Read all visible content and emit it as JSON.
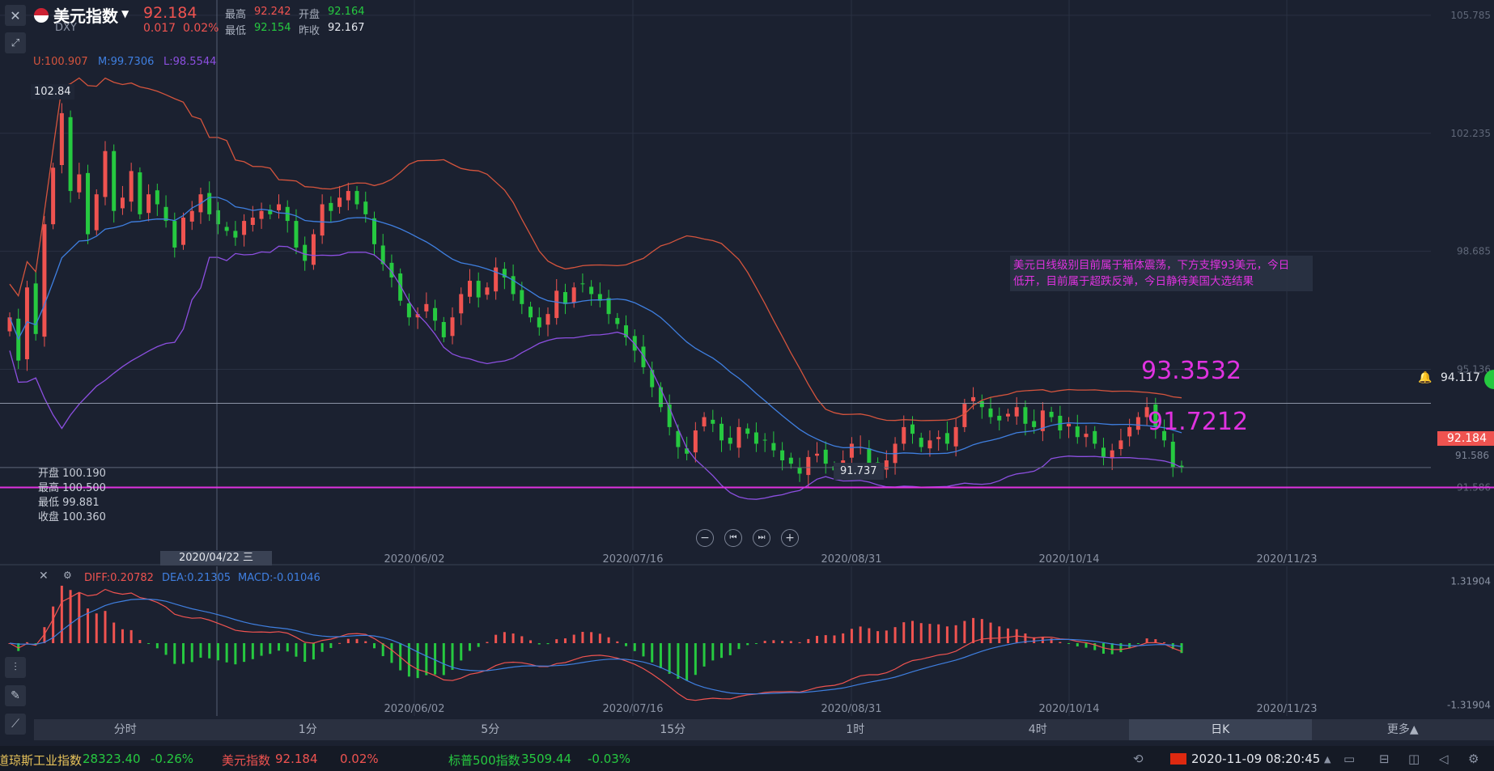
{
  "header": {
    "title": "美元指数",
    "symbol": "DXY",
    "price": "92.184",
    "change": "0.017",
    "change_pct": "0.02%",
    "high_label": "最高",
    "high": "92.242",
    "open_label": "开盘",
    "open": "92.164",
    "low_label": "最低",
    "low": "92.154",
    "prev_close_label": "昨收",
    "prev_close": "92.167"
  },
  "bollinger_legend": {
    "upper": "U:100.907",
    "middle": "M:99.7306",
    "lower": "L:98.5544"
  },
  "crosshair": {
    "ohlc": [
      "开盘 100.190",
      "最高 100.500",
      "最低 99.881",
      "收盘 100.360"
    ],
    "date_label": "2020/04/22 三"
  },
  "annotation": {
    "text_line1": "美元日线级别目前属于箱体震荡，下方支撑93美元，今日",
    "text_line2": "低开，目前属于超跌反弹，今日静待美国大选结果",
    "resistance_value": "93.3532",
    "support_value": "91.7212"
  },
  "price_tags": {
    "current": "92.184",
    "crosshair_level": "94.117",
    "high_marker": "102.84",
    "low_marker": "91.737",
    "support_line": "91.586"
  },
  "macd_legend": {
    "diff": "DIFF:0.20782",
    "dea": "DEA:0.21305",
    "macd": "MACD:-0.01046"
  },
  "timeframes": [
    "分时",
    "1分",
    "5分",
    "15分",
    "1时",
    "4时",
    "日K",
    "更多▲"
  ],
  "active_timeframe": "日K",
  "ticker": [
    {
      "name": "道琼斯工业指数",
      "price": "28323.40",
      "change": "-0.26%"
    },
    {
      "name": "美元指数",
      "price": "92.184",
      "change": "0.02%"
    },
    {
      "name": "标普500指数",
      "price": "3509.44",
      "change": "-0.03%"
    }
  ],
  "datetime": "2020-11-09 08:20:45",
  "colors": {
    "up": "#ef5350",
    "down": "#26c940",
    "upper_band": "#d4543d",
    "middle_band": "#3f7fe0",
    "lower_band": "#8c4fe0",
    "annotation": "#e032e0",
    "background": "#1b2130"
  },
  "chart_data": [
    {
      "type": "candlestick",
      "title": "美元指数 DXY",
      "x_ticks": [
        "2020/06/02",
        "2020/07/16",
        "2020/08/31",
        "2020/10/14",
        "2020/11/23"
      ],
      "y_ticks": [
        "105.785",
        "102.235",
        "98.685",
        "95.136",
        "91.586"
      ],
      "ylim": [
        89.7,
        106.0
      ],
      "closes": [
        96.7,
        95.4,
        97.6,
        96.2,
        99.5,
        101.2,
        102.84,
        100.5,
        101.0,
        99.2,
        100.4,
        101.7,
        99.9,
        100.3,
        101.1,
        99.8,
        100.4,
        100.1,
        99.6,
        98.8,
        99.7,
        99.9,
        100.4,
        99.8,
        99.5,
        99.3,
        99.1,
        99.6,
        99.7,
        99.9,
        99.8,
        100.1,
        99.6,
        98.8,
        98.4,
        99.2,
        100.1,
        99.9,
        100.3,
        100.5,
        100.1,
        99.8,
        98.9,
        98.3,
        97.9,
        97.2,
        96.7,
        96.8,
        97.1,
        96.6,
        96.1,
        96.7,
        97.4,
        97.8,
        97.3,
        97.6,
        98.2,
        97.9,
        97.4,
        97.1,
        96.7,
        96.4,
        96.8,
        97.5,
        97.1,
        97.6,
        97.7,
        97.4,
        97.2,
        96.8,
        96.5,
        96.1,
        95.7,
        95.2,
        94.6,
        94.0,
        93.4,
        92.8,
        92.6,
        93.3,
        93.7,
        93.5,
        93.0,
        92.9,
        93.4,
        93.2,
        92.9,
        93.0,
        92.7,
        92.4,
        92.3,
        92.0,
        92.5,
        92.6,
        92.3,
        92.1,
        92.4,
        92.9,
        92.8,
        92.3,
        92.0,
        92.4,
        92.9,
        93.4,
        93.2,
        92.8,
        93.0,
        93.1,
        92.9,
        93.4,
        94.1,
        94.3,
        94.0,
        93.7,
        93.6,
        93.8,
        94.0,
        93.5,
        93.4,
        93.9,
        93.7,
        93.3,
        93.5,
        93.1,
        93.2,
        92.9,
        92.5,
        92.7,
        93.0,
        93.4,
        93.7,
        94.0,
        93.4,
        93.0,
        92.2,
        92.18
      ],
      "series": [
        {
          "name": "U:100.907"
        },
        {
          "name": "M:99.7306"
        },
        {
          "name": "L:98.5544"
        }
      ],
      "notes": [
        "93.3532",
        "91.7212"
      ]
    },
    {
      "type": "bar",
      "title": "MACD",
      "y_ticks": [
        "1.31904",
        "-1.31904"
      ],
      "ylim": [
        -1.55,
        1.55
      ],
      "series": [
        {
          "name": "DIFF:0.20782"
        },
        {
          "name": "DEA:0.21305"
        },
        {
          "name": "MACD:-0.01046"
        }
      ]
    }
  ]
}
